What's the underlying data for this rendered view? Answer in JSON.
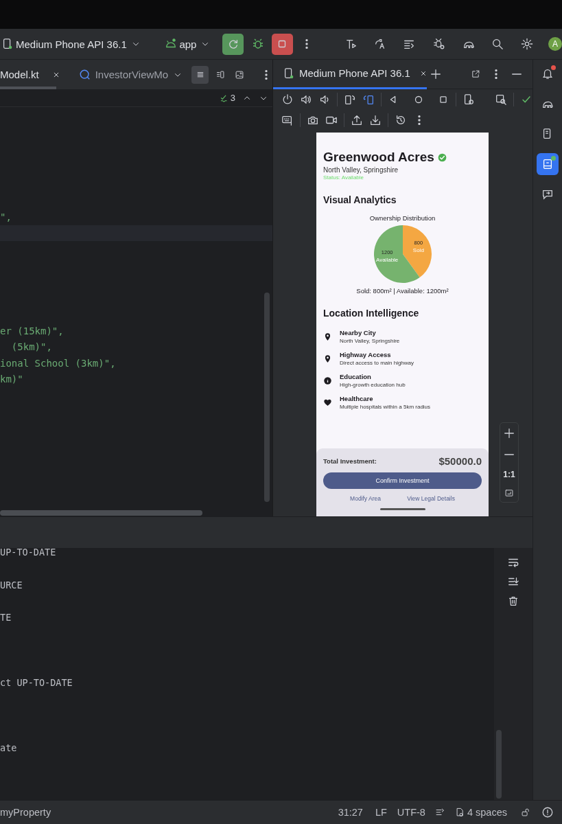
{
  "toolbar": {
    "device": "Medium Phone API 36.1",
    "module": "app",
    "avatar": "A"
  },
  "editor": {
    "tabs": [
      {
        "label": "Model.kt",
        "selected": true
      },
      {
        "label": "InvestorViewMo",
        "selected": false
      }
    ],
    "view_modes": [
      {
        "selected": true
      },
      {
        "selected": false
      },
      {
        "selected": false
      }
    ],
    "inspection_count": "3",
    "code_blocks": [
      [
        "\","
      ],
      [
        "er (15km)\",",
        "  (5km)\",",
        "ional School (3km)\",",
        "km)\""
      ]
    ]
  },
  "emulator": {
    "tabs": [
      {
        "label": "Medium Phone API 36.1",
        "selected": true
      }
    ],
    "zoom_actual_size": "1:1",
    "app": {
      "title": "Greenwood Acres",
      "verified": true,
      "location": "North Valley, Springshire",
      "status": "Status: Available",
      "analytics_heading": "Visual Analytics",
      "chart_data": {
        "type": "pie",
        "title": "Ownership Distribution",
        "categories": [
          "Sold",
          "Available"
        ],
        "values": [
          800,
          1200
        ],
        "data_labels": true
      },
      "chart_caption": "Sold: 800m² | Available: 1200m²",
      "location_heading": "Location Intelligence",
      "features": [
        {
          "kind": "pin",
          "title": "Nearby City",
          "detail": "North Valley, Springshire"
        },
        {
          "kind": "pin",
          "title": "Highway Access",
          "detail": "Direct access to main highway"
        },
        {
          "kind": "info",
          "title": "Education",
          "detail": "High-growth education hub"
        },
        {
          "kind": "heart",
          "title": "Healthcare",
          "detail": "Multiple hospitals within a 5km radius"
        }
      ],
      "total_label": "Total Investment:",
      "total_value": "$50000.0",
      "confirm_button": "Confirm Investment",
      "links": [
        "Modify Area",
        "View Legal Details"
      ]
    }
  },
  "console": {
    "blocks": [
      [
        "UP-TO-DATE",
        "URCE",
        "TE"
      ],
      [
        "ct UP-TO-DATE"
      ],
      [
        "ate"
      ]
    ]
  },
  "sidebar": {
    "items": [
      {
        "kind": "notifications",
        "selected": false,
        "color": "#e5534b"
      },
      {
        "kind": "gradle",
        "selected": false
      },
      {
        "kind": "device-manager",
        "selected": false
      },
      {
        "kind": "running-devices",
        "selected": true,
        "color": "#5fb865"
      },
      {
        "kind": "mirroring",
        "selected": false
      }
    ]
  },
  "status_bar": {
    "context": "myProperty",
    "position": "31:27",
    "line_separator": "LF",
    "encoding": "UTF-8",
    "indent": "4 spaces"
  }
}
